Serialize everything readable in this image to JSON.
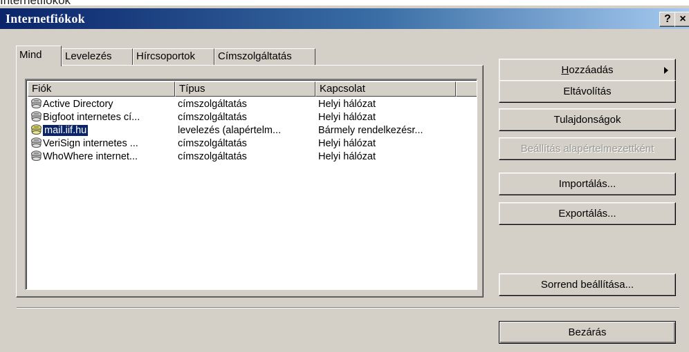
{
  "caption_fragment": "Internetfiókok",
  "window": {
    "title": "Internetfiókok",
    "help_label": "?",
    "close_label": "×"
  },
  "tabs": [
    {
      "label": "Mind",
      "active": true
    },
    {
      "label": "Levelezés",
      "active": false
    },
    {
      "label": "Hírcsoportok",
      "active": false
    },
    {
      "label": "Címszolgáltatás",
      "active": false
    }
  ],
  "list": {
    "columns": [
      "Fiók",
      "Típus",
      "Kapcsolat"
    ],
    "rows": [
      {
        "account": "Active Directory",
        "type": "címszolgáltatás",
        "connection": "Helyi hálózat",
        "selected": false
      },
      {
        "account": "Bigfoot internetes cí...",
        "type": "címszolgáltatás",
        "connection": "Helyi hálózat",
        "selected": false
      },
      {
        "account": "mail.iif.hu",
        "type": "levelezés (alapértelm...",
        "connection": "Bármely rendelkezésr...",
        "selected": true
      },
      {
        "account": "VeriSign internetes ...",
        "type": "címszolgáltatás",
        "connection": "Helyi hálózat",
        "selected": false
      },
      {
        "account": "WhoWhere internet...",
        "type": "címszolgáltatás",
        "connection": "Helyi hálózat",
        "selected": false
      }
    ]
  },
  "buttons": {
    "add": "Hozzáadás",
    "add_accel": "H",
    "add_rest": "ozzáadás",
    "remove": "Eltávolítás",
    "properties": "Tulajdonságok",
    "set_default": "Beállítás alapértelmezettként",
    "import": "Importálás...",
    "export": "Exportálás...",
    "order": "Sorrend beállítása...",
    "close": "Bezárás"
  },
  "icons": {
    "account": "account-icon",
    "submenu_arrow": "chevron-right-icon",
    "help": "help-icon",
    "close": "close-icon"
  },
  "colors": {
    "title_start": "#0a246a",
    "title_end": "#a6caf0",
    "face": "#d4d0c8",
    "selection": "#0a246a"
  }
}
